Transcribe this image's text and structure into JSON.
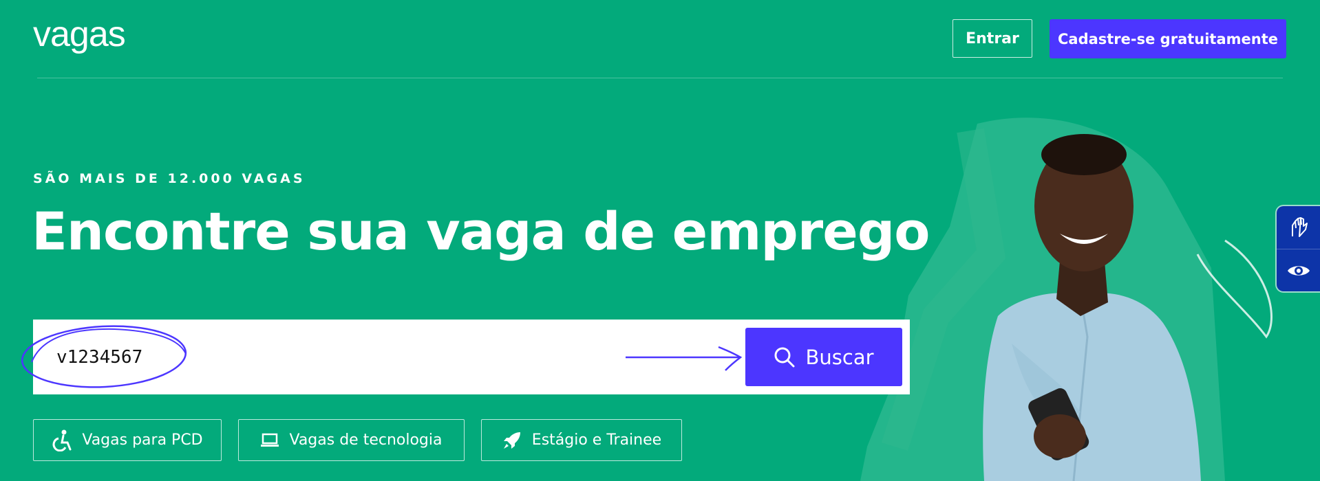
{
  "header": {
    "logo": "vagas",
    "login_label": "Entrar",
    "signup_label": "Cadastre-se gratuitamente"
  },
  "hero": {
    "eyebrow": "SÃO MAIS DE 12.000 VAGAS",
    "title": "Encontre sua vaga de emprego"
  },
  "search": {
    "value": "v1234567",
    "button_label": "Buscar",
    "annotation_color": "#4c36ff"
  },
  "categories": [
    {
      "label": "Vagas para PCD",
      "icon": "accessibility-icon"
    },
    {
      "label": "Vagas de tecnologia",
      "icon": "laptop-icon"
    },
    {
      "label": "Estágio e Trainee",
      "icon": "rocket-icon"
    }
  ],
  "accessibility": {
    "items": [
      {
        "icon": "sign-language-icon"
      },
      {
        "icon": "eye-icon"
      }
    ]
  },
  "colors": {
    "background": "#03aa7b",
    "accent": "#4c36ff",
    "a11y_panel": "#0d34a8"
  }
}
